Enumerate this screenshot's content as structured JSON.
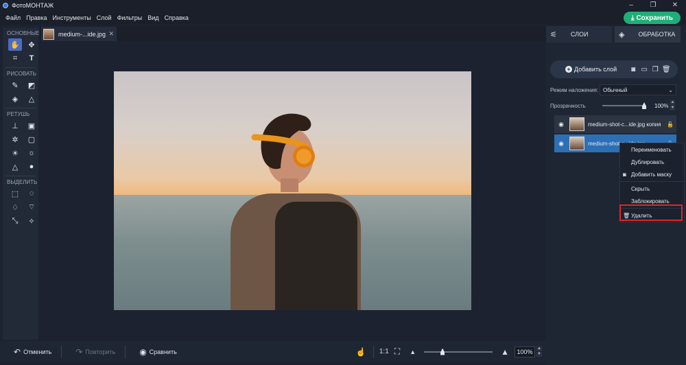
{
  "app": {
    "title": "ФотоМОНТАЖ"
  },
  "window_controls": [
    "–",
    "❐",
    "✕"
  ],
  "menu": [
    "Файл",
    "Правка",
    "Инструменты",
    "Слой",
    "Фильтры",
    "Вид",
    "Справка"
  ],
  "save_button": {
    "label": "Сохранить",
    "color": "#1fae78"
  },
  "document_tab": {
    "name": "medium-...ide.jpg"
  },
  "tool_sections": [
    {
      "title": "ОСНОВНЫЕ",
      "tools": [
        "hand-icon",
        "move-icon",
        "crop-icon",
        "text-icon"
      ]
    },
    {
      "title": "РИСОВАТЬ",
      "tools": [
        "brush-icon",
        "eraser-icon",
        "fill-icon",
        "shapes-icon"
      ]
    },
    {
      "title": "РЕТУШЬ",
      "tools": [
        "stamp-icon",
        "patch-icon",
        "heal-icon",
        "frame-icon",
        "sun-icon",
        "brightness-icon",
        "sharpen-icon",
        "drop-icon"
      ]
    },
    {
      "title": "ВЫДЕЛИТЬ",
      "tools": [
        "rect-select-icon",
        "ellipse-select-icon",
        "lasso-icon",
        "poly-lasso-icon",
        "magnetic-lasso-icon",
        "magic-wand-icon"
      ]
    }
  ],
  "bottom_bar": {
    "undo": "Отменить",
    "redo": "Повторить",
    "compare": "Сравнить",
    "ratio": "1:1",
    "zoom": "100%"
  },
  "right_panel": {
    "tabs": [
      "СЛОИ",
      "ОБРАБОТКА"
    ],
    "add_layer": "Добавить слой",
    "blend_label": "Режим наложения:",
    "blend_value": "Обычный",
    "opacity_label": "Прозрачность",
    "opacity_value": "100%",
    "opacity": 1.0,
    "layers": [
      {
        "name": "medium-shot-c...ide.jpg копия",
        "selected": false
      },
      {
        "name": "medium-shot-c...ide.jpg",
        "selected": true
      }
    ]
  },
  "context_menu": {
    "items": [
      "Переименовать",
      "Дублировать",
      "Добавить маску",
      "Скрыть",
      "Заблокировать",
      "Удалить"
    ],
    "highlighted": "Удалить",
    "highlight_color": "#e0262a"
  }
}
